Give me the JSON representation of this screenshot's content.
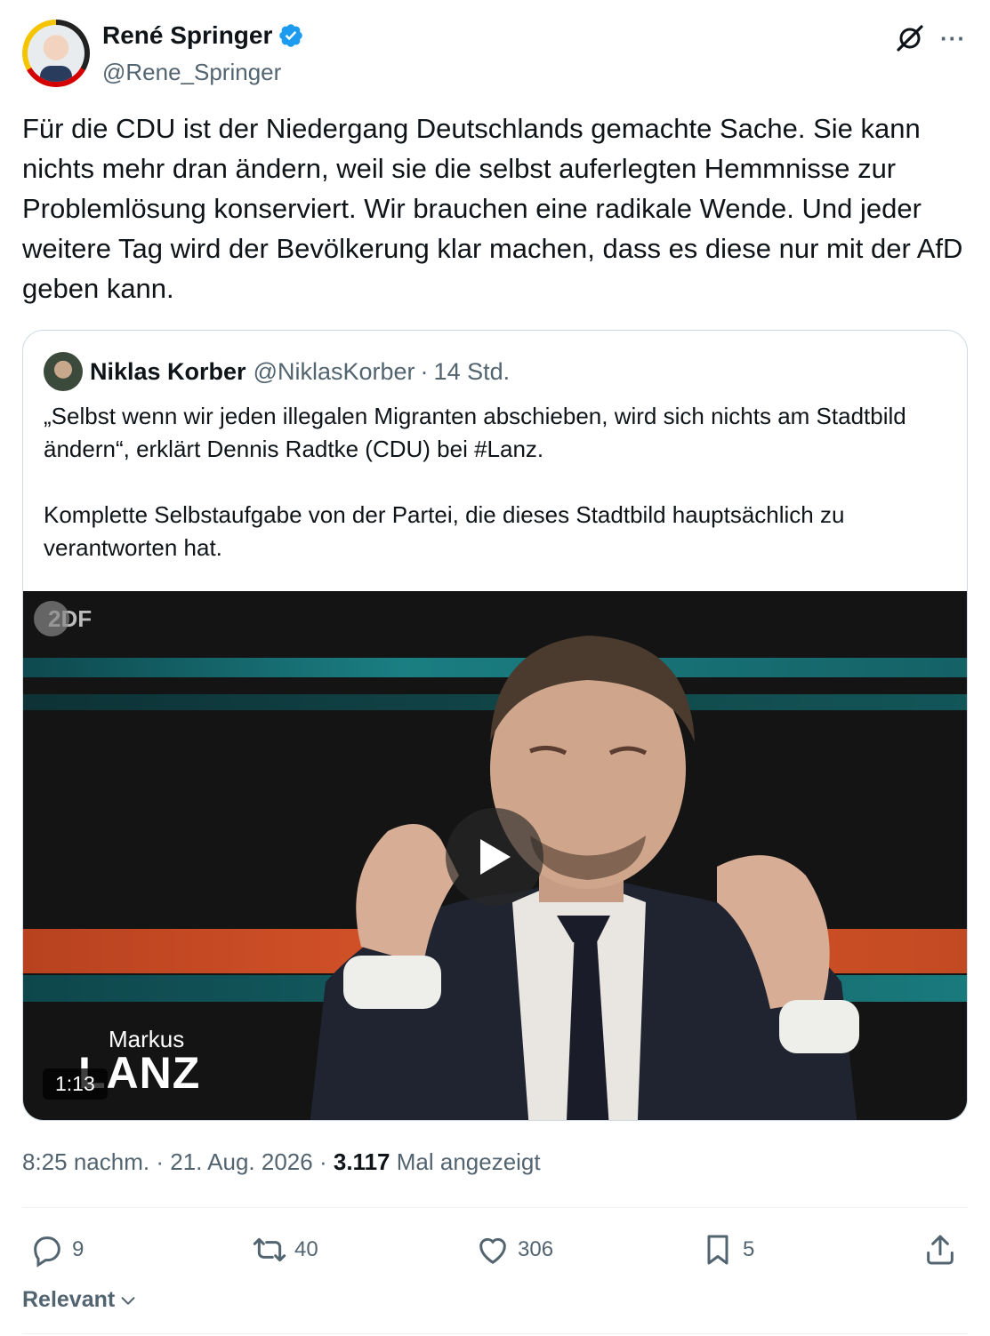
{
  "author": {
    "name": "René Springer",
    "handle": "@Rene_Springer",
    "verified": true
  },
  "tweet": {
    "text": "Für die CDU ist der Niedergang Deutschlands gemachte Sache. Sie kann nichts mehr dran ändern, weil sie die selbst auferlegten Hemmnisse zur Problemlösung konserviert. Wir brauchen eine radikale Wende. Und jeder weitere Tag wird der Bevölkerung klar machen, dass es diese nur mit der AfD geben kann."
  },
  "quoted": {
    "name": "Niklas Korber",
    "handle": "@NiklasKorber",
    "separator": "·",
    "time": "14 Std.",
    "text": "„Selbst wenn wir jeden illegalen Migranten abschieben, wird sich nichts am Stadtbild ändern“, erklärt Dennis Radtke (CDU) bei #Lanz.\n\nKomplette Selbstaufgabe von der Partei, die dieses Stadtbild hauptsächlich zu verantworten hat.",
    "video": {
      "channel_logo": "2DF",
      "show_small": "Markus",
      "show_big": "LANZ",
      "duration": "1:13"
    }
  },
  "meta": {
    "time": "8:25 nachm.",
    "date": "21. Aug. 2026",
    "sep": "·",
    "views": "3.117",
    "views_label": "Mal angezeigt"
  },
  "actions": {
    "replies": "9",
    "reposts": "40",
    "likes": "306",
    "bookmarks": "5"
  },
  "sort": {
    "label": "Relevant"
  },
  "colors": {
    "text": "#0f1419",
    "muted": "#536471",
    "verified": "#1d9bf0",
    "border": "#cfd9de"
  },
  "icons": [
    "verified-badge-icon",
    "grok-icon",
    "more-icon",
    "play-icon",
    "reply-icon",
    "repost-icon",
    "like-icon",
    "bookmark-icon",
    "share-icon",
    "chevron-down-icon"
  ]
}
